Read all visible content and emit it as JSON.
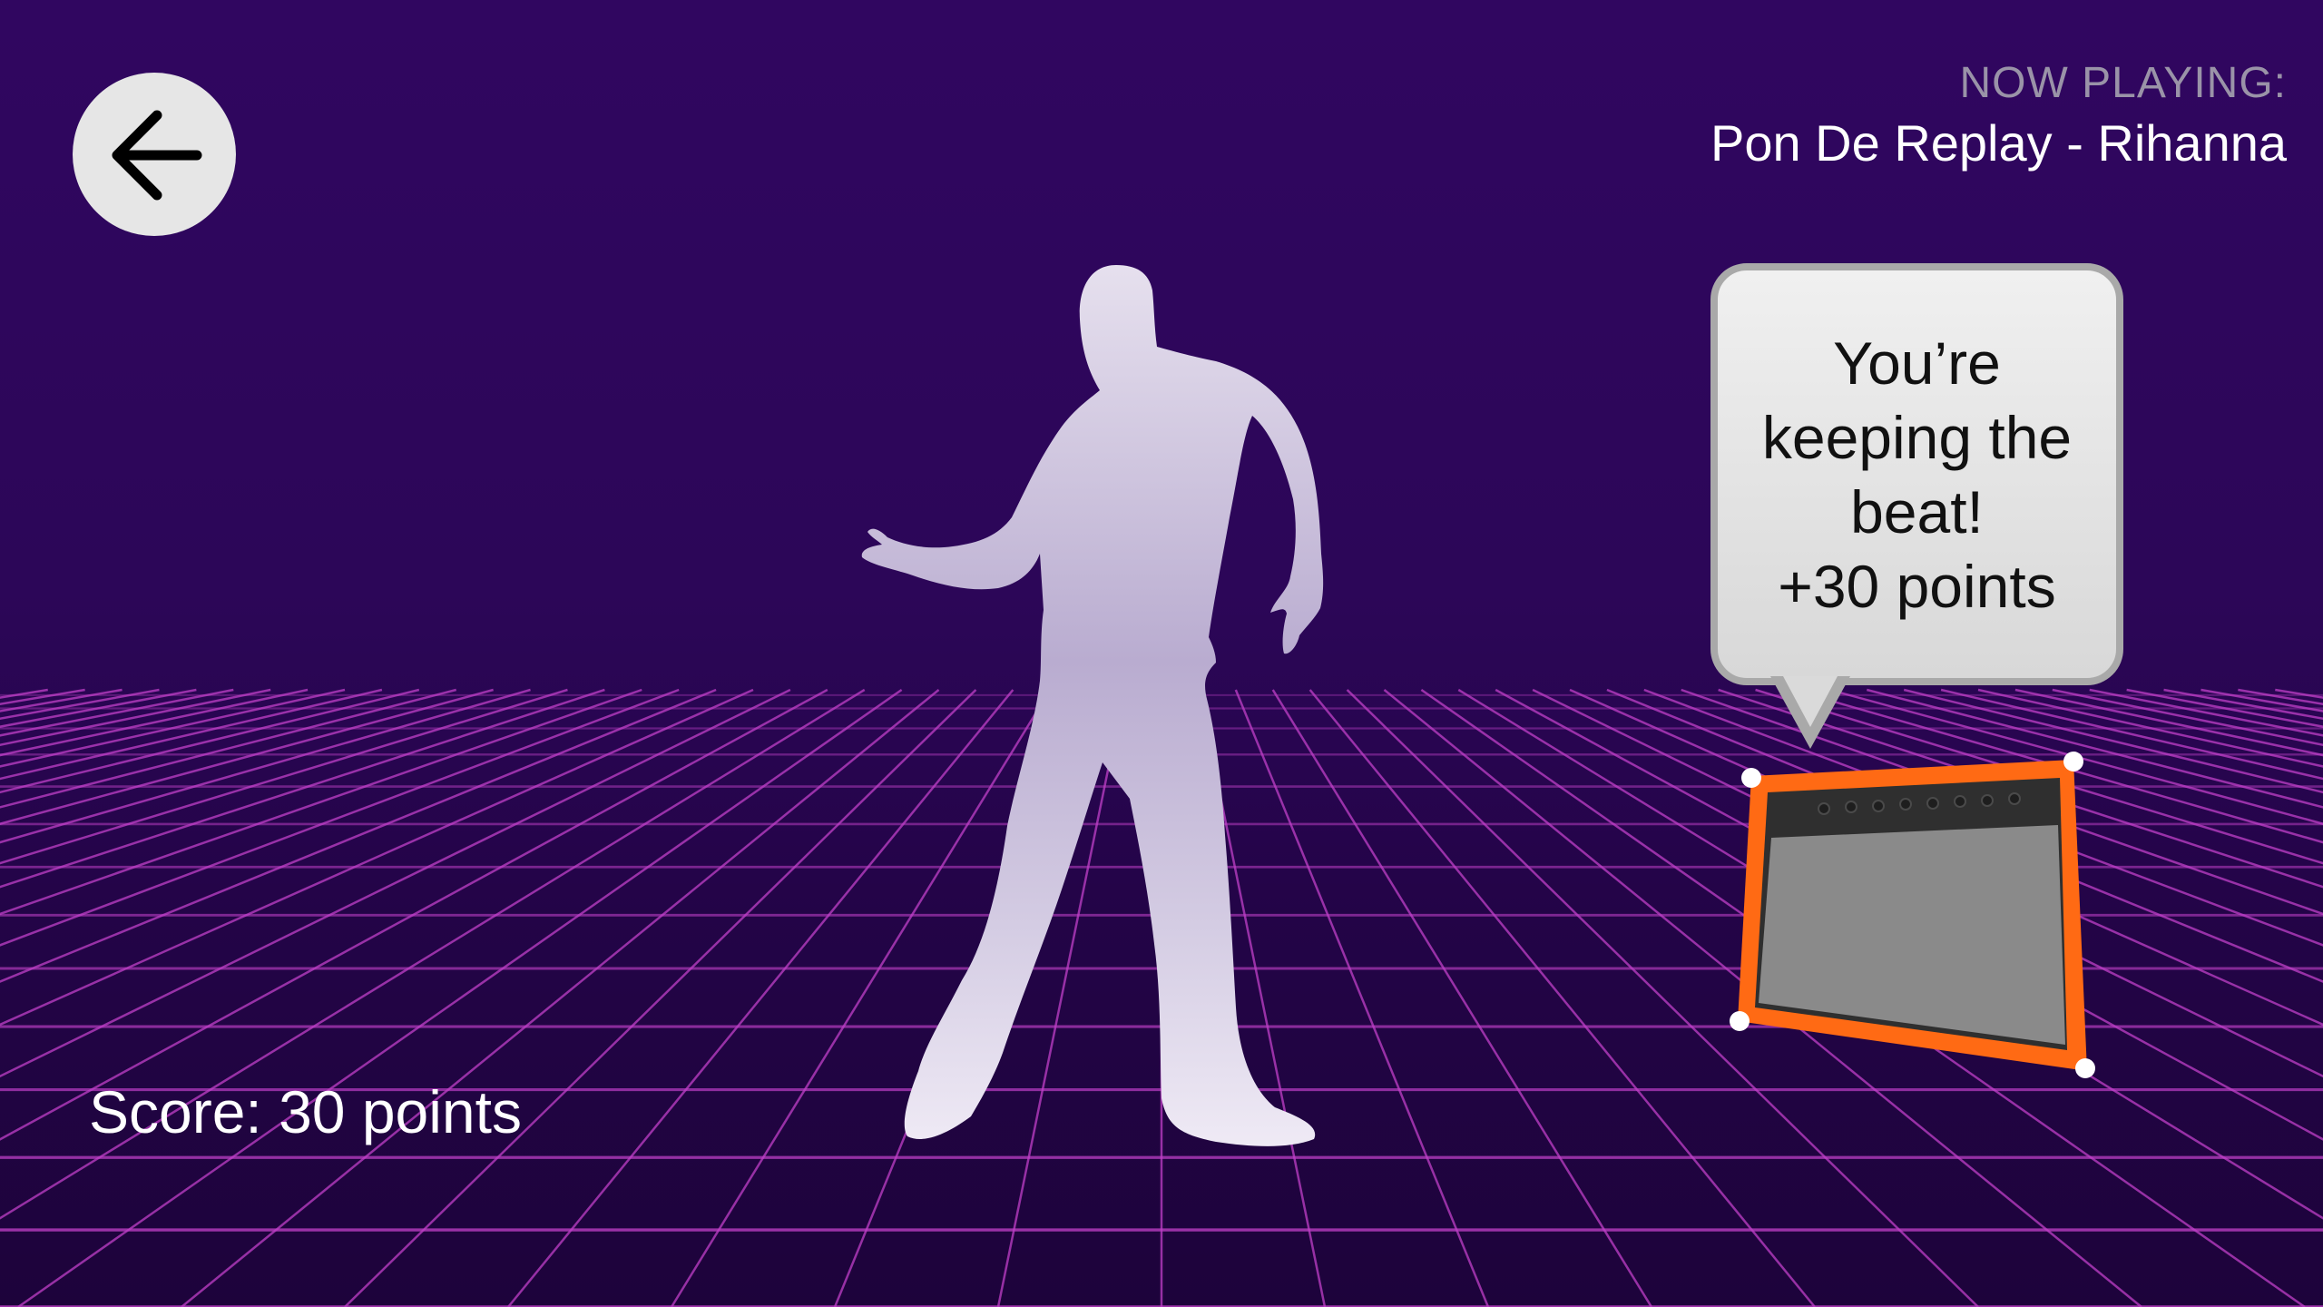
{
  "header": {
    "back_button_icon": "arrow-left-icon",
    "now_playing_label": "NOW PLAYING:",
    "now_playing_track": "Pon De Replay - Rihanna"
  },
  "feedback": {
    "line1": "You’re",
    "line2": "keeping the",
    "line3": "beat!",
    "line4": "+30 points"
  },
  "score": {
    "text": "Score: 30 points"
  },
  "scene": {
    "dancer_icon": "dancer-silhouette",
    "amp_icon": "guitar-amplifier-icon"
  },
  "colors": {
    "background_top": "#300660",
    "grid_line": "#c040c8",
    "dancer": "#d9d0e8",
    "amp_frame": "#ff6a14",
    "bubble": "#e6e6e6"
  }
}
